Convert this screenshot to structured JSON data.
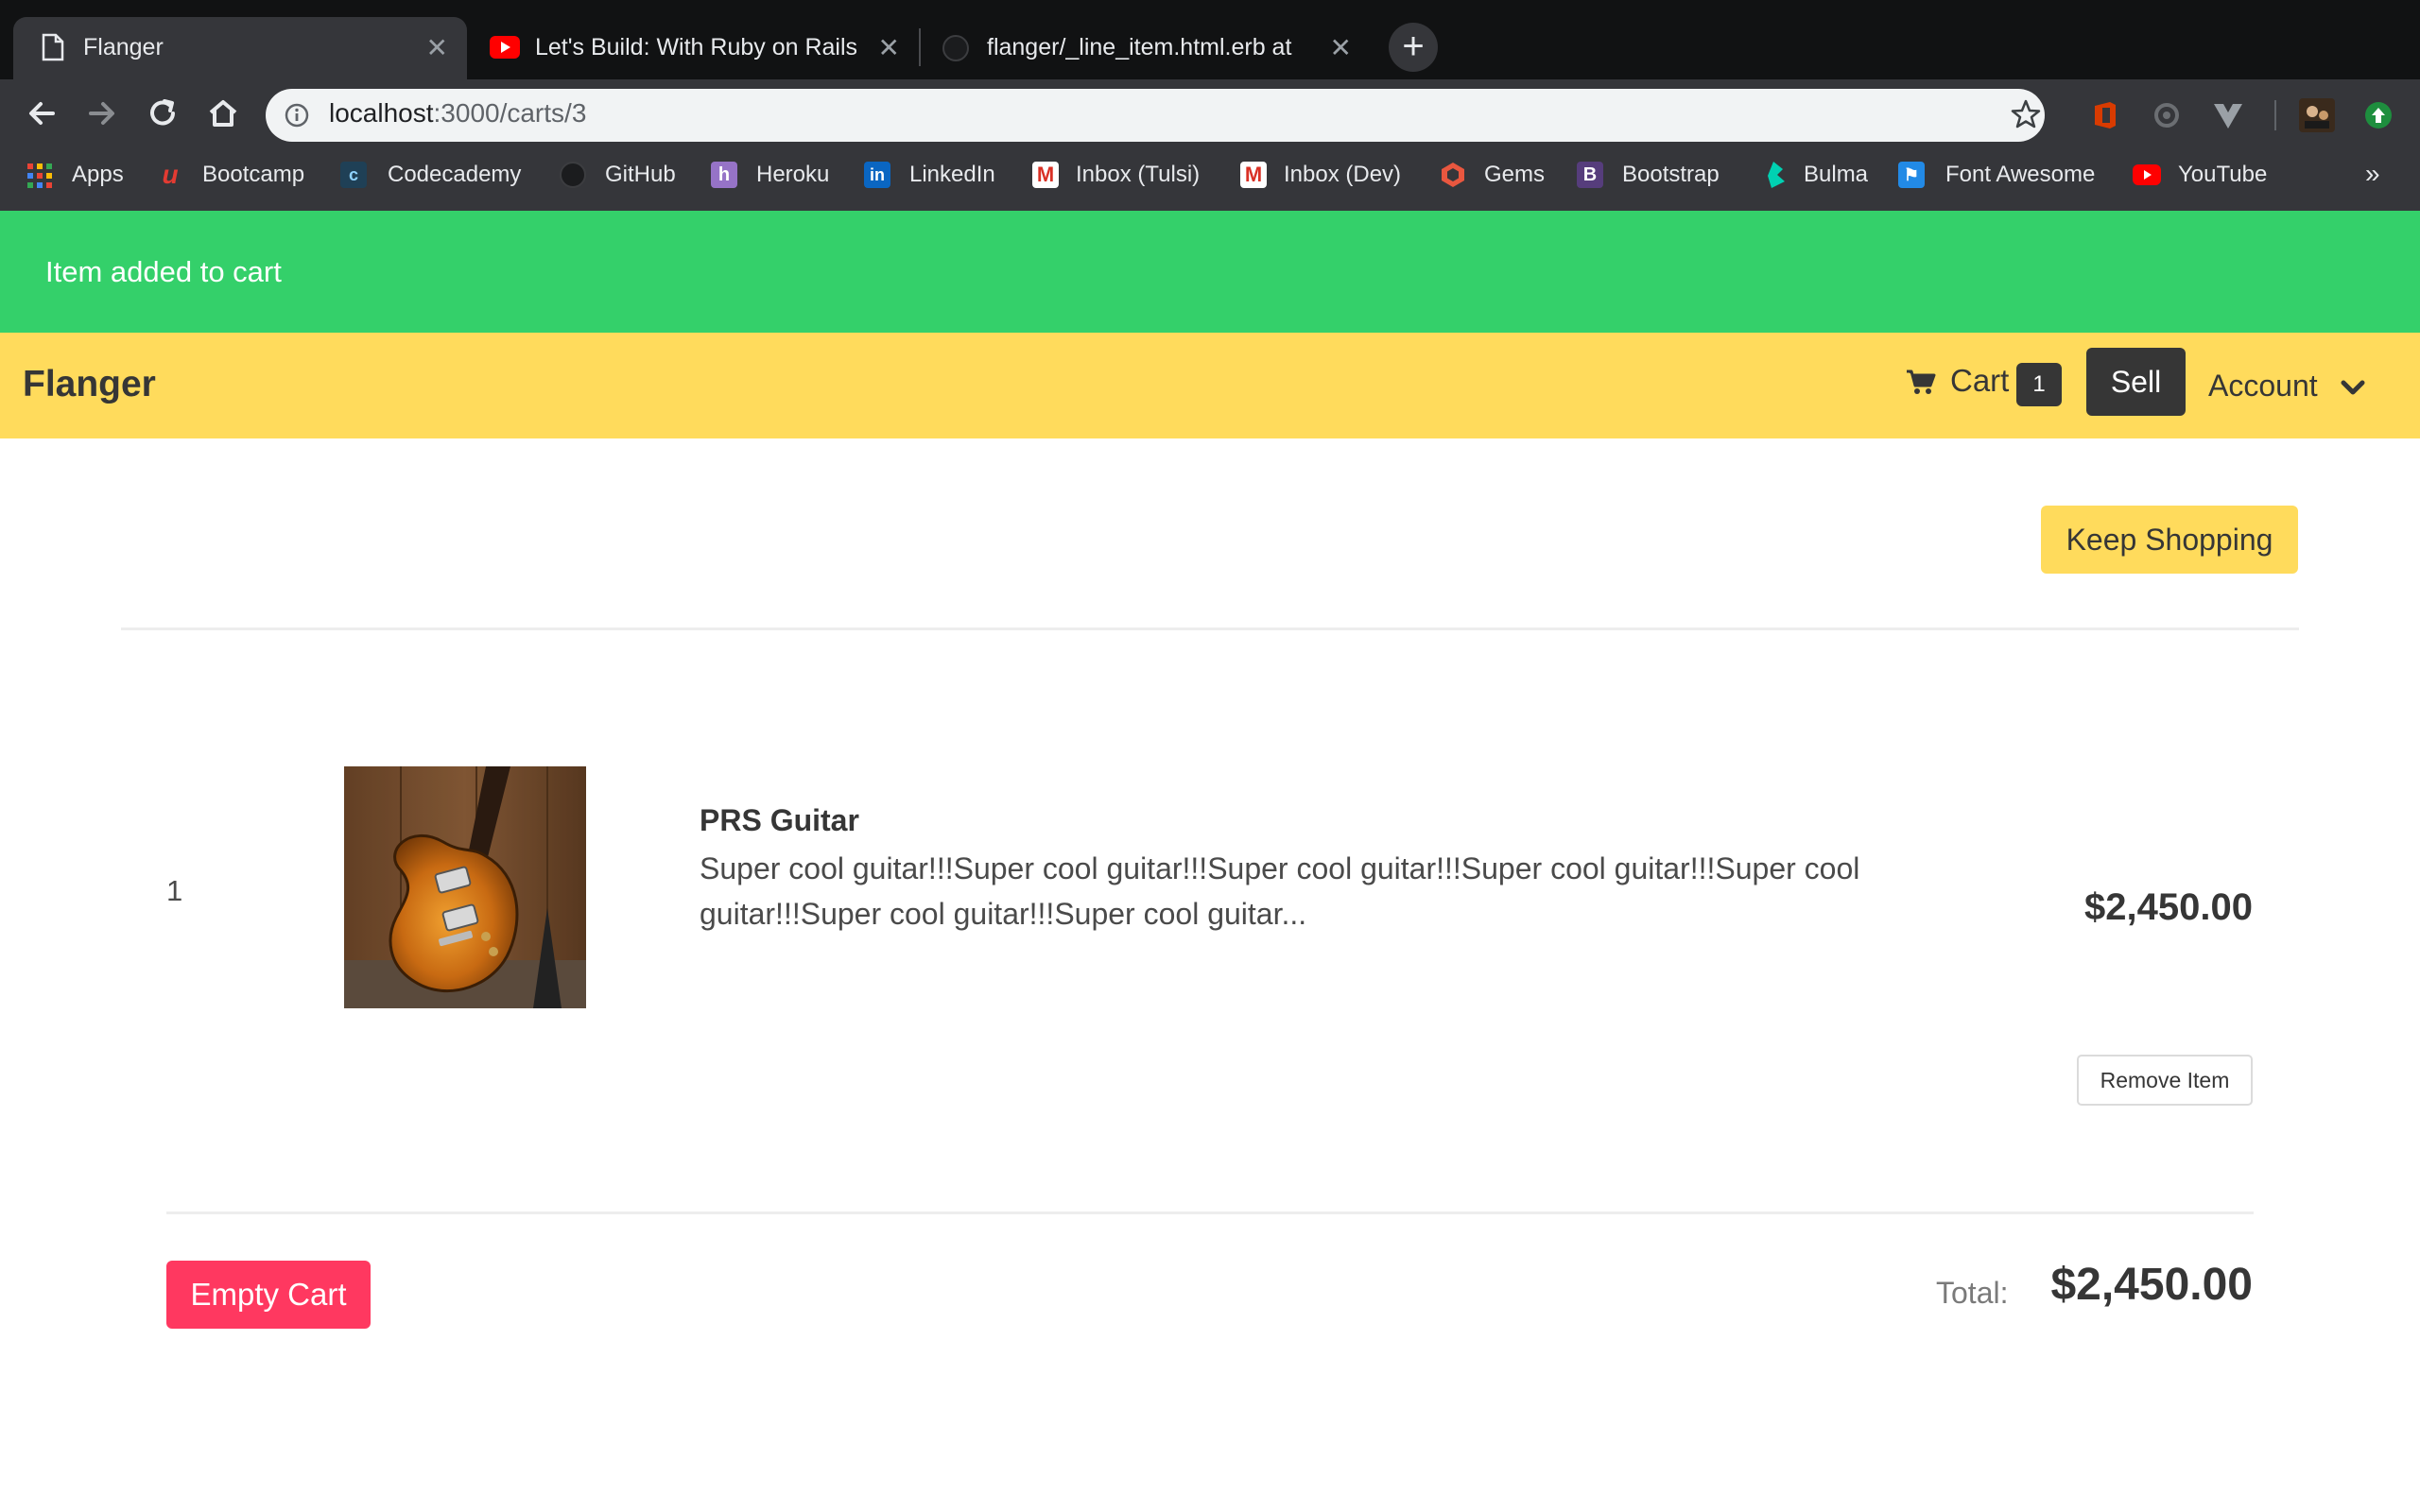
{
  "browser": {
    "tabs": [
      {
        "title": "Flanger",
        "active": true
      },
      {
        "title": "Let's Build: With Ruby on Rails",
        "active": false
      },
      {
        "title": "flanger/_line_item.html.erb at m",
        "active": false
      }
    ],
    "url_host": "localhost",
    "url_path": ":3000/carts/3",
    "bookmarks": [
      {
        "label": "Apps",
        "icon": "apps-grid-icon"
      },
      {
        "label": "Bootcamp",
        "icon": "bootcamp-icon"
      },
      {
        "label": "Codecademy",
        "icon": "codecademy-icon"
      },
      {
        "label": "GitHub",
        "icon": "github-icon"
      },
      {
        "label": "Heroku",
        "icon": "heroku-icon"
      },
      {
        "label": "LinkedIn",
        "icon": "linkedin-icon"
      },
      {
        "label": "Inbox (Tulsi)",
        "icon": "gmail-icon"
      },
      {
        "label": "Inbox (Dev)",
        "icon": "gmail-icon"
      },
      {
        "label": "Gems",
        "icon": "rubygems-icon"
      },
      {
        "label": "Bootstrap",
        "icon": "bootstrap-icon"
      },
      {
        "label": "Bulma",
        "icon": "bulma-icon"
      },
      {
        "label": "Font Awesome",
        "icon": "font-awesome-icon"
      },
      {
        "label": "YouTube",
        "icon": "youtube-icon"
      }
    ],
    "more_bookmarks": "»"
  },
  "flash": {
    "message": "Item added to cart",
    "color": "#34d06a"
  },
  "navbar": {
    "brand": "Flanger",
    "cart_label": "Cart",
    "cart_count": "1",
    "sell_label": "Sell",
    "account_label": "Account",
    "color": "#ffdb5c"
  },
  "cart": {
    "keep_shopping": "Keep Shopping",
    "line_items": [
      {
        "quantity": "1",
        "name": "PRS Guitar",
        "description": "Super cool guitar!!!Super cool guitar!!!Super cool guitar!!!Super cool guitar!!!Super cool guitar!!!Super cool guitar!!!Super cool guitar...",
        "price": "$2,450.00",
        "remove_label": "Remove Item"
      }
    ],
    "empty_label": "Empty Cart",
    "total_label": "Total:",
    "total_value": "$2,450.00",
    "danger_color": "#ff3860"
  }
}
